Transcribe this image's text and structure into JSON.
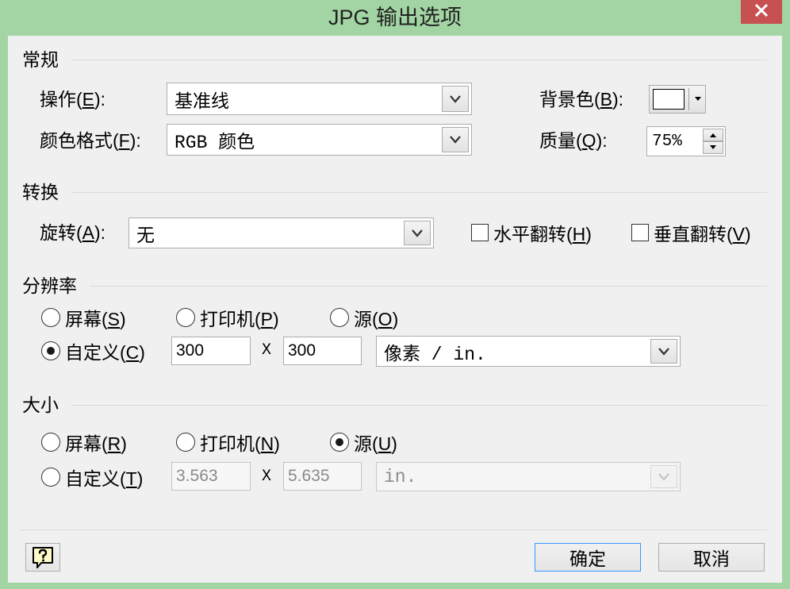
{
  "window": {
    "title": "JPG 输出选项",
    "frame_color": "#a2d5a3",
    "close_button_color": "#c75050"
  },
  "icons": {
    "close": "close-icon",
    "dropdown": "chevron-down-icon",
    "spin_up": "triangle-up-icon",
    "spin_down": "triangle-down-icon",
    "color_dropdown": "triangle-down-icon",
    "help": "help-icon"
  },
  "general": {
    "title": "常规",
    "operation": {
      "label": "操作(E):",
      "value": "基准线"
    },
    "color_format": {
      "label": "颜色格式(F):",
      "value": "RGB 颜色"
    },
    "background_color": {
      "label": "背景色(B):",
      "swatch": "#ffffff"
    },
    "quality": {
      "label": "质量(Q):",
      "value": "75%"
    }
  },
  "transform": {
    "title": "转换",
    "rotation": {
      "label": "旋转(A):",
      "value": "无"
    },
    "flip_horizontal": {
      "label": "水平翻转(H)",
      "checked": false
    },
    "flip_vertical": {
      "label": "垂直翻转(V)",
      "checked": false
    }
  },
  "resolution": {
    "title": "分辨率",
    "screen": {
      "label": "屏幕(S)",
      "checked": false
    },
    "printer": {
      "label": "打印机(P)",
      "checked": false
    },
    "source": {
      "label": "源(O)",
      "checked": false
    },
    "custom": {
      "label": "自定义(C)",
      "checked": true
    },
    "width": "300",
    "times": "X",
    "height": "300",
    "unit": "像素 / in.",
    "custom_disabled": false
  },
  "size": {
    "title": "大小",
    "screen": {
      "label": "屏幕(R)",
      "checked": false
    },
    "printer": {
      "label": "打印机(N)",
      "checked": false
    },
    "source": {
      "label": "源(U)",
      "checked": true
    },
    "custom": {
      "label": "自定义(T)",
      "checked": false
    },
    "width": "3.563",
    "times": "X",
    "height": "5.635",
    "unit": "in.",
    "custom_disabled": true
  },
  "buttons": {
    "ok": "确定",
    "cancel": "取消"
  }
}
